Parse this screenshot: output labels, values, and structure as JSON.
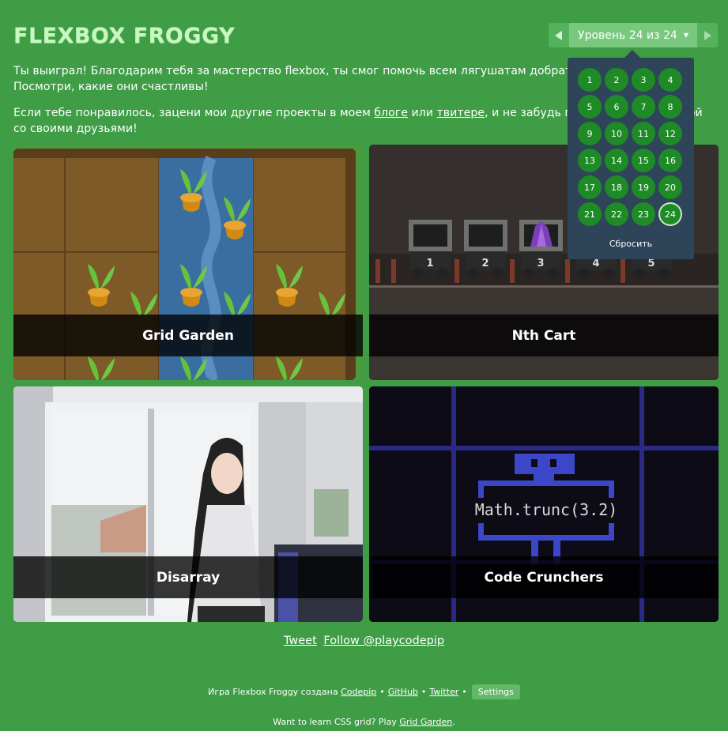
{
  "header": {
    "title": "FLEXBOX FROGGY",
    "level_indicator": "Уровень 24 из 24",
    "prev_icon": "triangle-left-icon",
    "next_icon": "triangle-right-icon"
  },
  "intro": {
    "p1": "Ты выиграл! Благодарим тебя за мастерство flexbox, ты смог помочь всем лягушатам добраться до их лилий. Посмотри, какие они счастливы!",
    "p2_before": "Если тебе понравилось, зацени мои другие проекты в моем ",
    "blog_link": "блоге",
    "p2_mid": " или ",
    "twitter_link": "твитере",
    "p2_after": ", и не забудь поделиться этой игрой со своими друзьями!"
  },
  "projects": [
    {
      "label": "Grid Garden"
    },
    {
      "label": "Nth Cart"
    },
    {
      "label": "Disarray"
    },
    {
      "label": "Code Crunchers"
    }
  ],
  "tile_art": {
    "cart_numbers": [
      "1",
      "2",
      "3",
      "4",
      "5"
    ],
    "code_text": "Math.trunc(3.2)"
  },
  "footer": {
    "tweet": "Tweet",
    "follow": "Follow @playcodepip",
    "credits_text": "Игра Flexbox Froggy создана",
    "codepip": "Codepip",
    "github": "GitHub",
    "twitter": "Twitter",
    "bullet": "•",
    "settings": "Settings",
    "learn_text": "Want to learn CSS grid? Play",
    "grid_garden": "Grid Garden",
    "learn_end": "."
  },
  "level_dropdown": {
    "levels": [
      "1",
      "2",
      "3",
      "4",
      "5",
      "6",
      "7",
      "8",
      "9",
      "10",
      "11",
      "12",
      "13",
      "14",
      "15",
      "16",
      "17",
      "18",
      "19",
      "20",
      "21",
      "22",
      "23",
      "24"
    ],
    "current": "24",
    "reset": "Сбросить"
  },
  "colors": {
    "background": "#3f9d46",
    "title": "#c8f7c0",
    "dropdown_bg": "#2e4458",
    "level_circle": "#1e8b26"
  }
}
